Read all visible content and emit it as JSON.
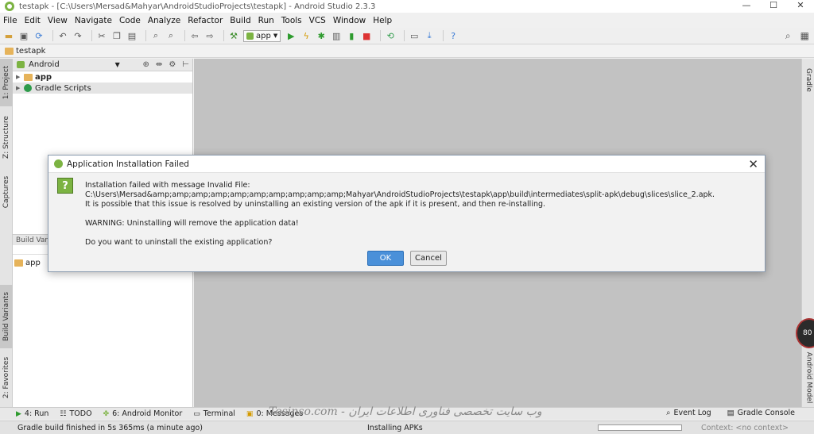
{
  "window": {
    "title": "testapk - [C:\\Users\\Mersad&Mahyar\\AndroidStudioProjects\\testapk] - Android Studio 2.3.3",
    "minimize": "—",
    "maximize": "☐",
    "close": "✕"
  },
  "menu": [
    "File",
    "Edit",
    "View",
    "Navigate",
    "Code",
    "Analyze",
    "Refactor",
    "Build",
    "Run",
    "Tools",
    "VCS",
    "Window",
    "Help"
  ],
  "toolbar": {
    "run_config": "app"
  },
  "breadcrumb": {
    "project": "testapk"
  },
  "left_tabs": {
    "project": "1: Project",
    "structure": "Z: Structure",
    "captures": "Captures",
    "build_variants": "Build Variants",
    "favorites": "2: Favorites"
  },
  "project_panel": {
    "view_mode": "Android",
    "items": [
      {
        "label": "app"
      },
      {
        "label": "Gradle Scripts"
      }
    ],
    "build_variants_header": "Build Varia",
    "build_variant_module": "app"
  },
  "right_tabs": {
    "gradle": "Gradle",
    "android_model": "Android Model"
  },
  "badge": {
    "value": "80"
  },
  "bottom_tools": {
    "run": "4: Run",
    "todo": "TODO",
    "android_monitor": "6: Android Monitor",
    "terminal": "Terminal",
    "messages": "0: Messages",
    "event_log": "Event Log",
    "gradle_console": "Gradle Console"
  },
  "watermark": "Tosinso.com - وب سایت تخصصی فناوری اطلاعات ایران",
  "status": {
    "left": "Gradle build finished in 5s 365ms (a minute ago)",
    "task": "Installing APKs",
    "context": "Context: <no context>"
  },
  "dialog": {
    "title": "Application Installation Failed",
    "icon": "?",
    "line1": "Installation failed with message Invalid File: C:\\Users\\Mersad&amp;amp;amp;amp;amp;amp;amp;amp;amp;amp;Mahyar\\AndroidStudioProjects\\testapk\\app\\build\\intermediates\\split-apk\\debug\\slices\\slice_2.apk.",
    "line2": "It is possible that this issue is resolved by uninstalling an existing version of the apk if it is present, and then re-installing.",
    "warning": "WARNING: Uninstalling will remove the application data!",
    "question": "Do you want to uninstall the existing application?",
    "ok": "OK",
    "cancel": "Cancel"
  }
}
